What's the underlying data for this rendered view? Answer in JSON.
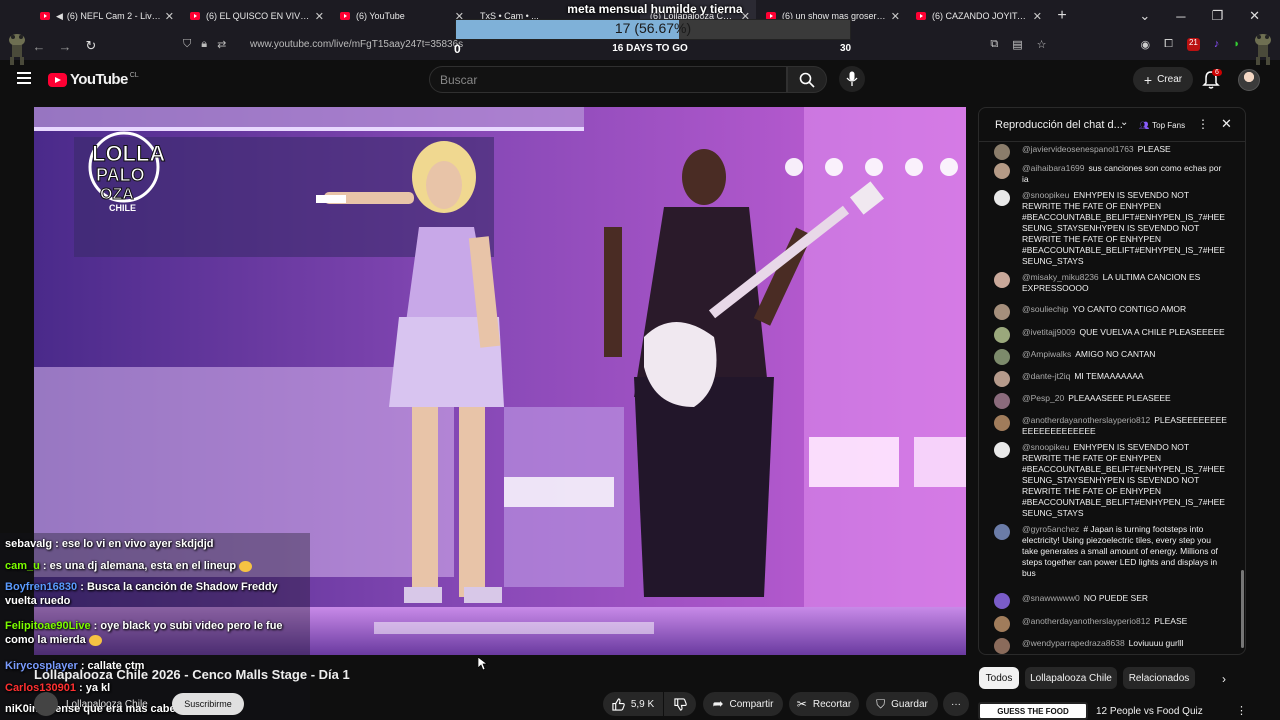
{
  "browser": {
    "tabs": [
      {
        "label": "(6) NEFL Cam 2 - Live Bald",
        "muted": true
      },
      {
        "label": "(6) EL QUISCO EN VIVO - YouTube",
        "muted": false
      },
      {
        "label": "(6) YouTube",
        "muted": false
      },
      {
        "label": "TxS • Cam • ...",
        "muted": false
      },
      {
        "label": "(6) Lollapalooza Chile 2026",
        "muted": false,
        "active": true
      },
      {
        "label": "(6) un show mas grosero - YouTube",
        "muted": false
      },
      {
        "label": "(6) CAZANDO JOYITAS",
        "muted": false
      }
    ],
    "url": "www.youtube.com/live/mFgT15aay247t=35836s",
    "extension_badge": "21"
  },
  "goal_overlay": {
    "title": "meta mensual humilde y tierna",
    "progress_text": "17 (56.67%)",
    "progress_fraction": 0.5667,
    "min": "0",
    "days_label": "16 DAYS TO GO",
    "max": "30"
  },
  "youtube": {
    "logo_text": "YouTube",
    "country_code": "CL",
    "search_placeholder": "Buscar",
    "create_label": "Crear",
    "notification_count": "6"
  },
  "video": {
    "brand_logo_lines": [
      "LOLLA",
      "PALO",
      "OZA",
      "CHILE"
    ],
    "title": "Lollapalooza Chile 2026 - Cenco Malls Stage - Día 1",
    "channel": "Lollapalooza Chile",
    "subscribe_label": "Suscribirme",
    "likes": "5,9 K",
    "share_label": "Compartir",
    "clip_label": "Recortar",
    "save_label": "Guardar"
  },
  "overlay_chat": [
    {
      "user": "sebavalg",
      "text": "ese lo vi en vivo ayer skdjdjd",
      "color": "#ffffff",
      "emoji": false
    },
    {
      "user": "cam_u",
      "text": "es una dj alemana, esta en el lineup",
      "color": "#7cfc00",
      "emoji": true
    },
    {
      "user": "Boyfren16830",
      "text": "Busca la canción de Shadow Freddy vuelta ruedo",
      "color": "#5b9bff",
      "emoji": false
    },
    {
      "user": "Felipitoae90Live",
      "text": "oye black yo subi video pero le fue como la mierda",
      "color": "#7cfc00",
      "emoji": true
    },
    {
      "user": "Kirycosplayer",
      "text": "callate ctm",
      "color": "#7a9cff",
      "emoji": false
    },
    {
      "user": "Carlos130901",
      "text": "ya kl",
      "color": "#ff3030",
      "emoji": false
    },
    {
      "user": "niK0in",
      "text": "pense que era mas cabezona",
      "color": "#ffffff",
      "emoji": false
    }
  ],
  "live_chat": {
    "header": "Reproducción del chat d...",
    "top_fans_label": "Top Fans",
    "messages": [
      {
        "user": "@javiervideosenespanol1763",
        "text": "PLEASE",
        "avatar": "#8b7d6b"
      },
      {
        "user": "@aihaibara1699",
        "text": "sus canciones son como echas por ia",
        "avatar": "#b49a86"
      },
      {
        "user": "@snoopikeu",
        "text": "ENHYPEN IS SEVENDO NOT REWRITE THE FATE OF ENHYPEN #BEACCOUNTABLE_BELIFT#ENHYPEN_IS_7#HEESEUNG_STAYSENHYPEN IS SEVENDO NOT REWRITE THE FATE OF ENHYPEN #BEACCOUNTABLE_BELIFT#ENHYPEN_IS_7#HEESEUNG_STAYS",
        "avatar": "#e8e8e8"
      },
      {
        "user": "@misaky_miku8236",
        "text": "LA ULTIMA CANCION ES EXPRESSOOOO",
        "avatar": "#c9a89a"
      },
      {
        "user": "@souliechip",
        "text": "YO CANTO CONTIGO AMOR",
        "avatar": "#a58f7c"
      },
      {
        "user": "@ivetitajj9009",
        "text": "QUE VUELVA A CHILE PLEASEEEEE",
        "avatar": "#9aa87c"
      },
      {
        "user": "@Ampiwalks",
        "text": "AMIGO NO CANTAN",
        "avatar": "#7c8a6b"
      },
      {
        "user": "@dante-jt2iq",
        "text": "MI TEMAAAAAAA",
        "avatar": "#b59a8b"
      },
      {
        "user": "@Pesp_20",
        "text": "PLEAAASEEE PLEASEEE",
        "avatar": "#8b6b7c"
      },
      {
        "user": "@anotherdayanotherslayperio812",
        "text": "PLEASEEEEEEEEEEEEEEEEEEEEE",
        "avatar": "#a07c5b"
      },
      {
        "user": "@snoopikeu",
        "text": "ENHYPEN IS SEVENDO NOT REWRITE THE FATE OF ENHYPEN #BEACCOUNTABLE_BELIFT#ENHYPEN_IS_7#HEESEUNG_STAYSENHYPEN IS SEVENDO NOT REWRITE THE FATE OF ENHYPEN #BEACCOUNTABLE_BELIFT#ENHYPEN_IS_7#HEESEUNG_STAYS",
        "avatar": "#e8e8e8"
      },
      {
        "user": "@gyro5anchez",
        "text": "# Japan is turning footsteps into electricity! Using piezoelectric tiles, every step you take generates a small amount of energy. Millions of steps together can power LED lights and displays in bus",
        "avatar": "#6b7ca8"
      },
      {
        "user": "@snawwwww0",
        "text": "NO PUEDE SER",
        "avatar": "#7a5cc8"
      },
      {
        "user": "@anotherdayanotherslayperio812",
        "text": "PLEASE",
        "avatar": "#a07c5b"
      },
      {
        "user": "@wendyparrapedraza8638",
        "text": "Loviuuuu gurlll",
        "avatar": "#8a6b5b"
      }
    ]
  },
  "chips": [
    "Todos",
    "Lollapalooza Chile",
    "Relacionados"
  ],
  "related": {
    "thumb_text": "GUESS THE FOOD",
    "title": "12 People vs Food Quiz"
  }
}
